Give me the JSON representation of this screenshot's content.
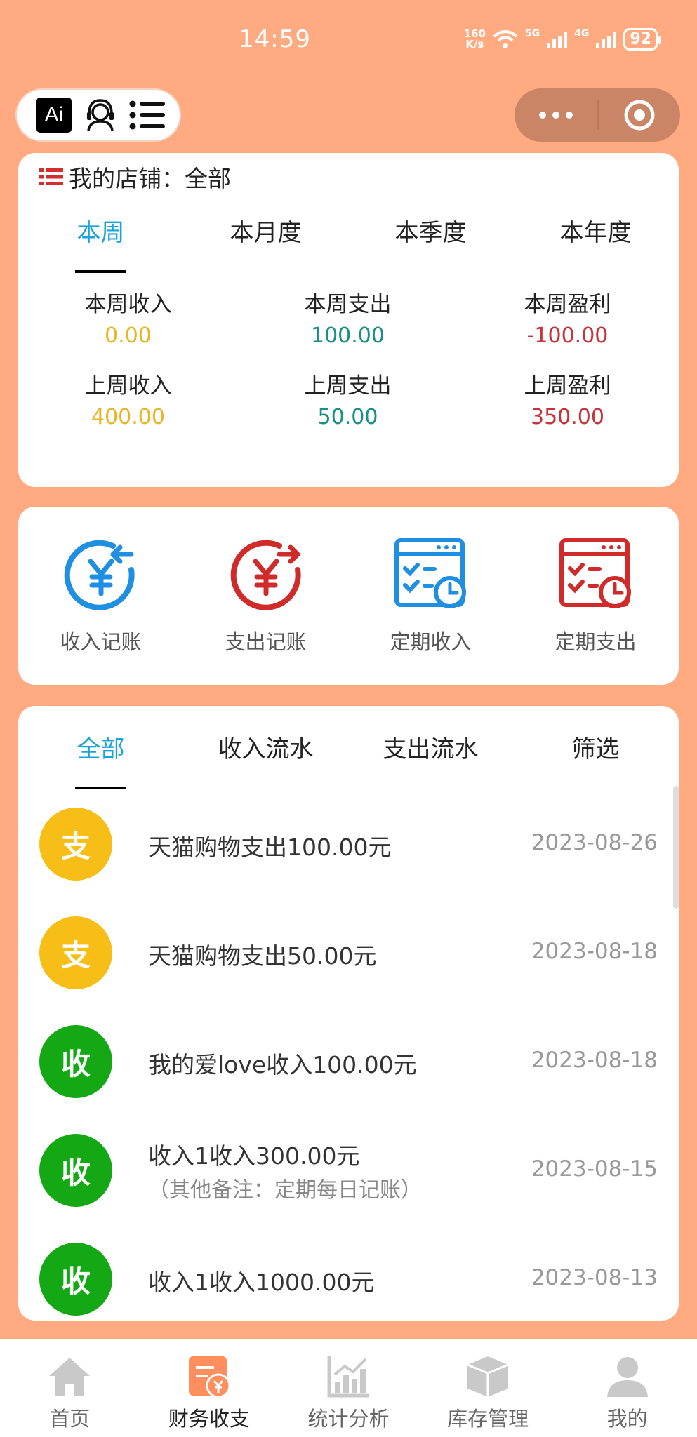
{
  "status_bar": {
    "time": "14:59",
    "net_speed_top": "160",
    "net_speed_bottom": "K/s",
    "sim1_label": "5G",
    "sim2_label": "4G",
    "battery": "92"
  },
  "header": {
    "ai_label": "Ai",
    "icons": [
      "ai-icon",
      "customer-service-icon",
      "menu-list-icon",
      "more-dots-icon",
      "target-close-icon"
    ]
  },
  "summary": {
    "shop_label": "我的店铺：全部",
    "tabs": [
      "本周",
      "本月度",
      "本季度",
      "本年度"
    ],
    "active_tab": "本周",
    "stats": [
      {
        "label": "本周收入",
        "value": "0.00",
        "color": "#E8B524"
      },
      {
        "label": "本周支出",
        "value": "100.00",
        "color": "#1A8F84"
      },
      {
        "label": "本周盈利",
        "value": "-100.00",
        "color": "#C8323A"
      },
      {
        "label": "上周收入",
        "value": "400.00",
        "color": "#E8B524"
      },
      {
        "label": "上周支出",
        "value": "50.00",
        "color": "#1A8F84"
      },
      {
        "label": "上周盈利",
        "value": "350.00",
        "color": "#C8323A"
      }
    ]
  },
  "actions": [
    {
      "label": "收入记账",
      "icon": "income-yen-icon",
      "color": "#1E8FE1"
    },
    {
      "label": "支出记账",
      "icon": "expense-yen-icon",
      "color": "#D02B2B"
    },
    {
      "label": "定期收入",
      "icon": "scheduled-income-icon",
      "color": "#1E8FE1"
    },
    {
      "label": "定期支出",
      "icon": "scheduled-expense-icon",
      "color": "#D02B2B"
    }
  ],
  "ledger": {
    "tabs": [
      "全部",
      "收入流水",
      "支出流水",
      "筛选"
    ],
    "active_tab": "全部",
    "rows": [
      {
        "badge": "支",
        "badge_color": "#F6BE16",
        "title": "天猫购物支出100.00元",
        "note": "",
        "date": "2023-08-26"
      },
      {
        "badge": "支",
        "badge_color": "#F6BE16",
        "title": "天猫购物支出50.00元",
        "note": "",
        "date": "2023-08-18"
      },
      {
        "badge": "收",
        "badge_color": "#14A814",
        "title": "我的爱love收入100.00元",
        "note": "",
        "date": "2023-08-18"
      },
      {
        "badge": "收",
        "badge_color": "#14A814",
        "title": "收入1收入300.00元",
        "note": "（其他备注：定期每日记账）",
        "date": "2023-08-15"
      },
      {
        "badge": "收",
        "badge_color": "#14A814",
        "title": "收入1收入1000.00元",
        "note": "",
        "date": "2023-08-13"
      }
    ]
  },
  "bottom_nav": [
    {
      "label": "首页",
      "icon": "home-icon"
    },
    {
      "label": "财务收支",
      "icon": "finance-icon"
    },
    {
      "label": "统计分析",
      "icon": "chart-icon"
    },
    {
      "label": "库存管理",
      "icon": "box-icon"
    },
    {
      "label": "我的",
      "icon": "user-icon"
    }
  ],
  "active_nav": "财务收支",
  "colors": {
    "background": "#FFAA80",
    "accent_blue": "#1AA3D8",
    "nav_active": "#FF8F5E",
    "nav_inactive": "#C9C9C9"
  }
}
